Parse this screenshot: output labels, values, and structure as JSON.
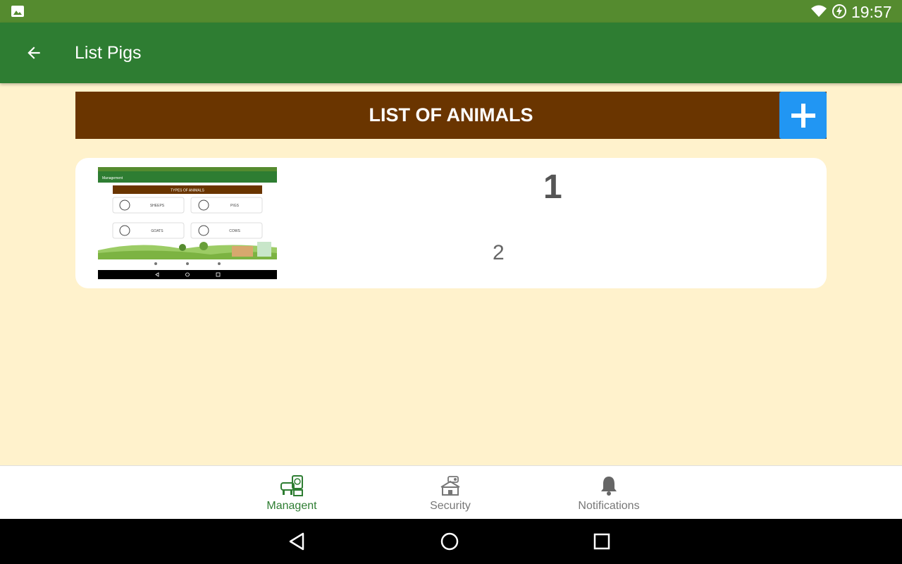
{
  "status_bar": {
    "time": "19:57",
    "icons": [
      "gallery-icon",
      "wifi-icon",
      "battery-charging-icon"
    ],
    "color": "#558b2f"
  },
  "app_bar": {
    "title": "List Pigs",
    "back_icon": "arrow-back-icon",
    "color": "#2e7d32"
  },
  "list_header": {
    "title": "LIST OF ANIMALS",
    "color": "#6a3500",
    "add_icon": "plus-icon",
    "add_color": "#2196f3"
  },
  "animals": [
    {
      "number": "1",
      "value": "2",
      "thumbnail": {
        "app_title": "Management",
        "header": "TYPES OF ANIMALS",
        "buttons": [
          "SHEEPS",
          "PIGS",
          "GOATS",
          "COWS"
        ]
      }
    }
  ],
  "bottom_nav": {
    "items": [
      {
        "label": "Managent",
        "icon": "farm-management-icon",
        "active": true
      },
      {
        "label": "Security",
        "icon": "security-camera-icon",
        "active": false
      },
      {
        "label": "Notifications",
        "icon": "bell-icon",
        "active": false
      }
    ],
    "active_color": "#2e7d32"
  },
  "system_nav": {
    "icons": [
      "back-triangle-icon",
      "home-circle-icon",
      "recents-square-icon"
    ]
  }
}
